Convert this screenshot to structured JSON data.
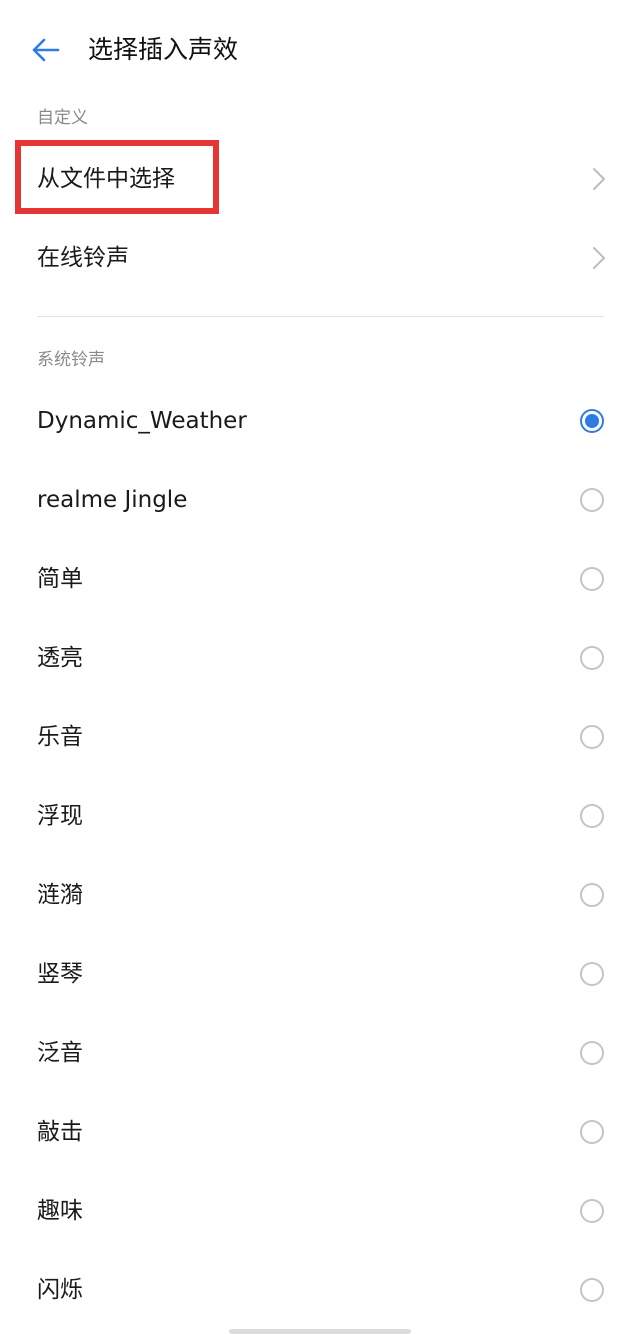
{
  "header": {
    "back_icon": "arrow-left-icon",
    "title": "选择插入声效"
  },
  "accent_color": "#2f7be5",
  "highlight_color": "#e53535",
  "custom_section": {
    "label": "自定义",
    "items": [
      {
        "label": "从文件中选择",
        "icon": "chevron-right-icon"
      },
      {
        "label": "在线铃声",
        "icon": "chevron-right-icon"
      }
    ]
  },
  "system_section": {
    "label": "系统铃声",
    "items": [
      {
        "label": "Dynamic_Weather",
        "selected": true
      },
      {
        "label": "realme Jingle",
        "selected": false
      },
      {
        "label": "简单",
        "selected": false
      },
      {
        "label": "透亮",
        "selected": false
      },
      {
        "label": "乐音",
        "selected": false
      },
      {
        "label": "浮现",
        "selected": false
      },
      {
        "label": "涟漪",
        "selected": false
      },
      {
        "label": "竖琴",
        "selected": false
      },
      {
        "label": "泛音",
        "selected": false
      },
      {
        "label": "敲击",
        "selected": false
      },
      {
        "label": "趣味",
        "selected": false
      },
      {
        "label": "闪烁",
        "selected": false
      }
    ]
  }
}
